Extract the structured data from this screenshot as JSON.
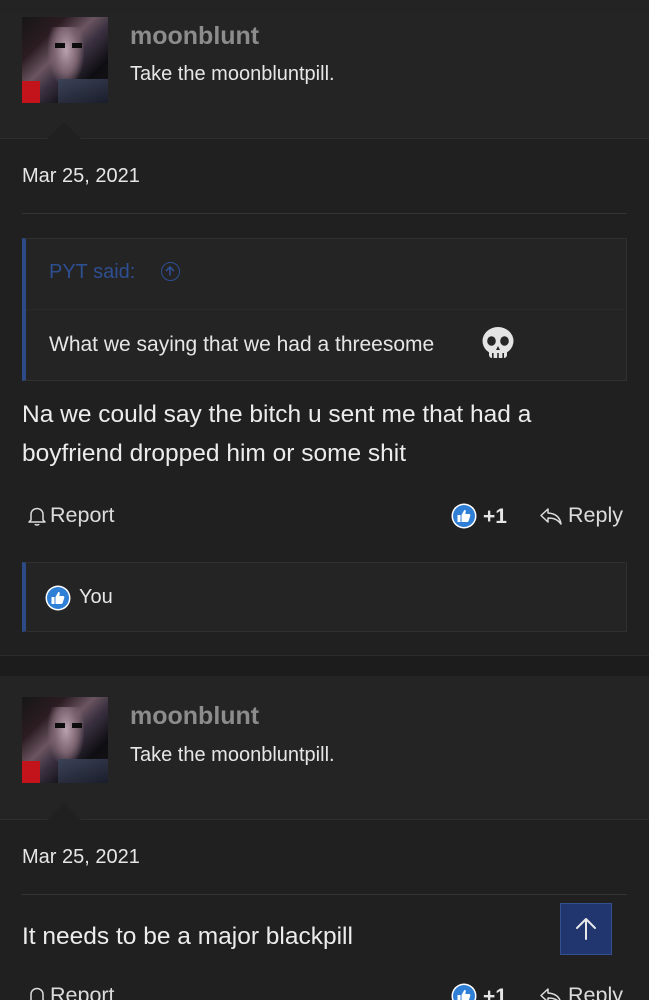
{
  "posts": [
    {
      "username": "moonblunt",
      "user_title": "Take the moonbluntpill.",
      "date": "Mar 25, 2021",
      "quote": {
        "author": "PYT said:",
        "text": "What we saying that we had a threesome",
        "emoji": "skull-emoji"
      },
      "message_lines": [
        "Na we could say the bitch u sent me that had a",
        "boyfriend dropped him or some shit"
      ],
      "actions": {
        "report": "Report",
        "reaction_count": "+1",
        "reply": "Reply"
      },
      "reactions_bar": {
        "text": "You"
      }
    },
    {
      "username": "moonblunt",
      "user_title": "Take the moonbluntpill.",
      "date": "Mar 25, 2021",
      "message_lines": [
        "It needs to be a major blackpill"
      ],
      "actions": {
        "report": "Report",
        "reaction_count": "+1",
        "reply": "Reply"
      }
    }
  ],
  "colors": {
    "background": "#202020",
    "accent_blue": "#2d4a86",
    "like_blue": "#2f7fd6",
    "username_gray": "#8c8c8c"
  },
  "icons": [
    "bell-icon",
    "like-icon",
    "reply-arrow-icon",
    "arrow-up-circle-icon",
    "scroll-to-top-icon"
  ]
}
